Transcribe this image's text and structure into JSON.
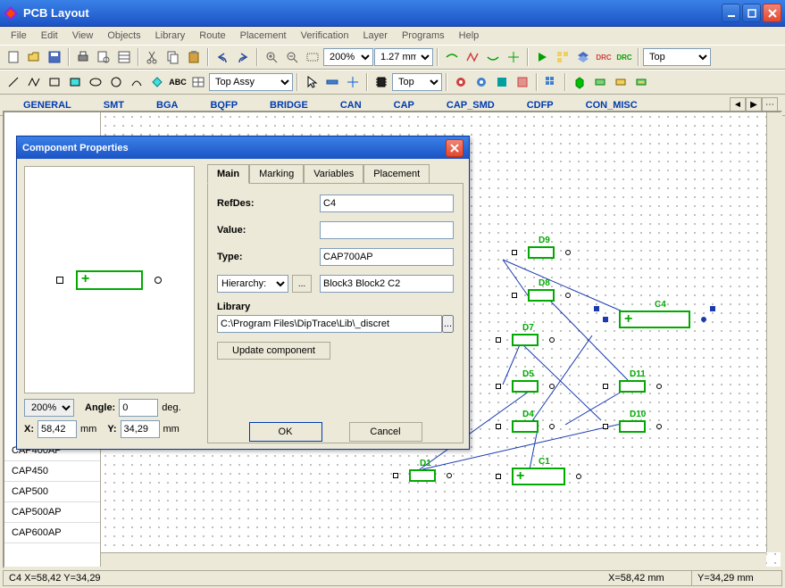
{
  "app": {
    "title": "PCB Layout"
  },
  "menu": [
    "File",
    "Edit",
    "View",
    "Objects",
    "Library",
    "Route",
    "Placement",
    "Verification",
    "Layer",
    "Programs",
    "Help"
  ],
  "toolbar1": {
    "zoom_value": "200%",
    "units_value": "1.27 mm",
    "layer_value": "Top"
  },
  "toolbar2": {
    "assy_value": "Top Assy",
    "side_value": "Top"
  },
  "libtabs": [
    "GENERAL",
    "SMT",
    "BGA",
    "BQFP",
    "BRIDGE",
    "CAN",
    "CAP",
    "CAP_SMD",
    "CDFP",
    "CON_MISC"
  ],
  "left_list": [
    "CAP400AP",
    "CAP450",
    "CAP500",
    "CAP500AP",
    "CAP600AP"
  ],
  "dialog": {
    "title": "Component Properties",
    "tabs": [
      "Main",
      "Marking",
      "Variables",
      "Placement"
    ],
    "refdes_label": "RefDes:",
    "refdes_value": "C4",
    "value_label": "Value:",
    "value_value": "",
    "type_label": "Type:",
    "type_value": "CAP700AP",
    "hierarchy_label": "Hierarchy:",
    "hierarchy_value": "Block3 Block2 C2",
    "library_label": "Library",
    "library_value": "C:\\Program Files\\DipTrace\\Lib\\_discret",
    "update_label": "Update component",
    "ok": "OK",
    "cancel": "Cancel",
    "zoom": "200%",
    "angle_label": "Angle:",
    "angle_value": "0",
    "angle_unit": "deg.",
    "x_label": "X:",
    "x_value": "58,42",
    "y_label": "Y:",
    "y_value": "34,29",
    "mm": "mm"
  },
  "canvas_components": {
    "d9": "D9",
    "d8": "D8",
    "d7": "D7",
    "d5": "D5",
    "d4": "D4",
    "d1": "D1",
    "d11": "D11",
    "d10": "D10",
    "c4": "C4",
    "c1": "C1"
  },
  "status": {
    "left": "C4  X=58,42  Y=34,29",
    "xcell": "X=58,42 mm",
    "ycell": "Y=34,29 mm"
  }
}
